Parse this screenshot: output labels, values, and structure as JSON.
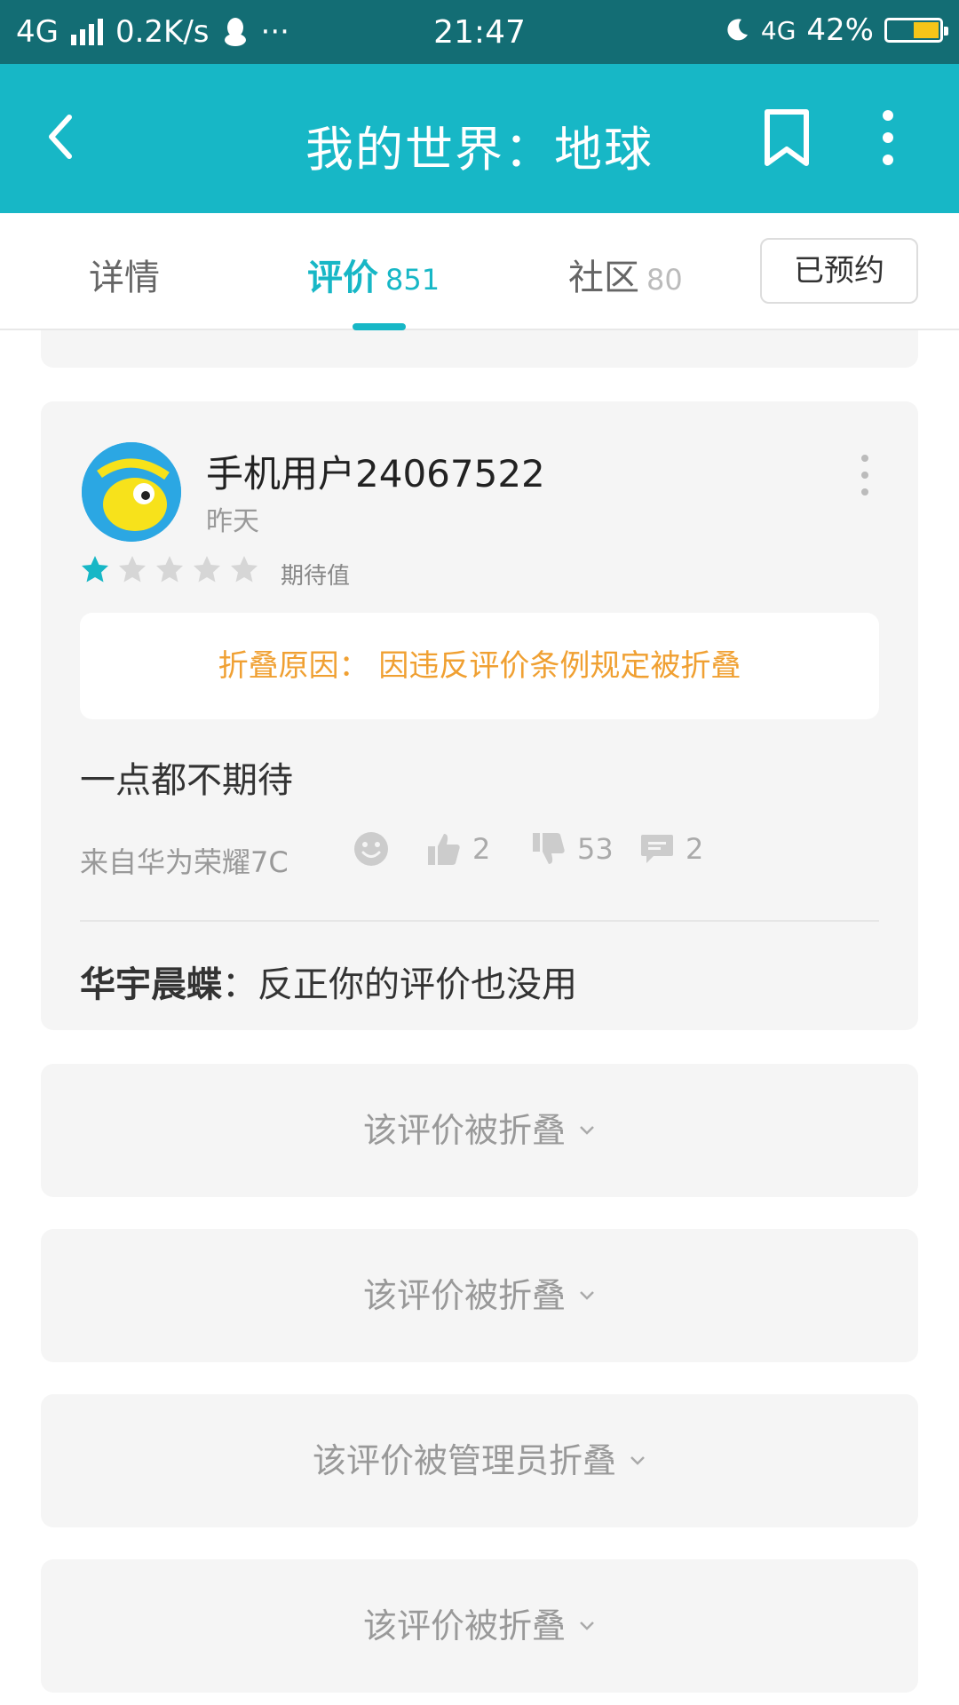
{
  "status_bar": {
    "network": "4G",
    "speed": "0.2K/s",
    "more": "···",
    "time": "21:47",
    "network2": "4G",
    "battery": "42%"
  },
  "app_bar": {
    "title": "我的世界：地球",
    "icons": [
      "back-arrow-icon",
      "bookmark-icon",
      "more-vertical-icon"
    ]
  },
  "tabs": [
    {
      "label": "详情",
      "count": ""
    },
    {
      "label": "评价",
      "count": "851"
    },
    {
      "label": "社区",
      "count": "80"
    }
  ],
  "reserved_button": "已预约",
  "review": {
    "username": "手机用户24067522",
    "time": "昨天",
    "rating": 1,
    "max_rating": 5,
    "rating_label": "期待值",
    "fold_reason": "折叠原因： 因违反评价条例规定被折叠",
    "content": "一点都不期待",
    "device": "来自华为荣耀7C",
    "likes": "2",
    "dislikes": "53",
    "comments": "2",
    "reply_author": "华宇晨蝶",
    "reply_text": "：反正你的评价也没用"
  },
  "folded_items": [
    "该评价被折叠",
    "该评价被折叠",
    "该评价被管理员折叠",
    "该评价被折叠"
  ],
  "colors": {
    "status_bar": "#136d74",
    "accent": "#17b7c6",
    "warning": "#f0a032",
    "card_bg": "#f5f5f5"
  }
}
